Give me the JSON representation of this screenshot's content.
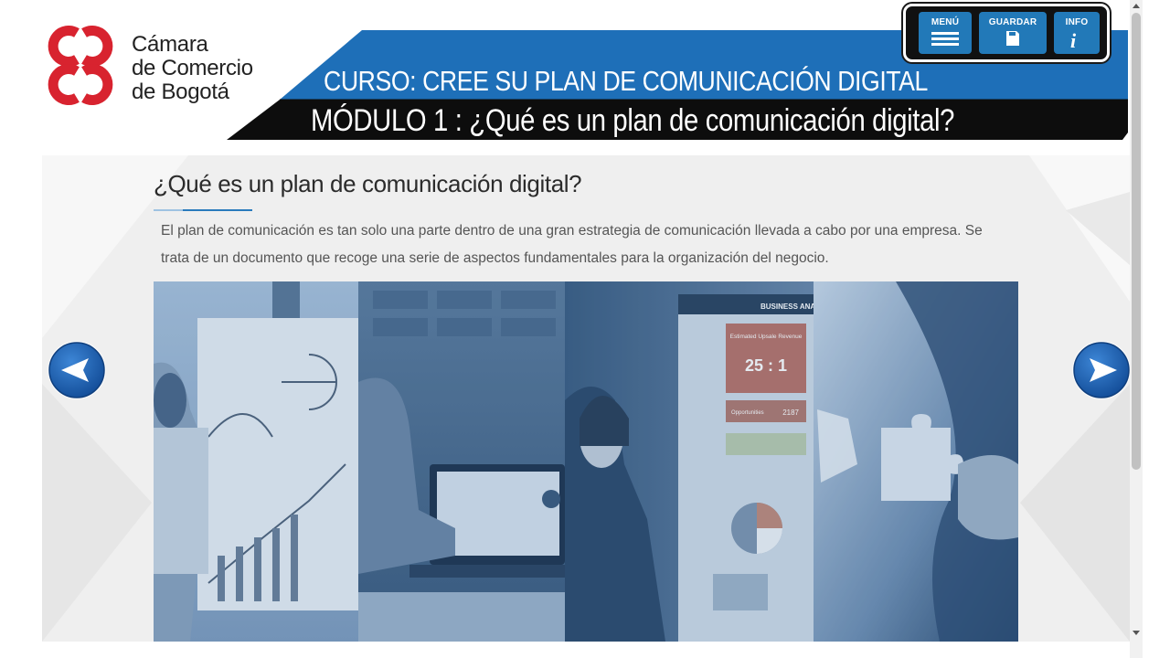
{
  "header": {
    "logo": {
      "line1": "Cámara",
      "line2": "de Comercio",
      "line3": "de Bogotá"
    },
    "course_title": "CURSO: CREE SU PLAN DE COMUNICACIÓN DIGITAL",
    "module_title": "MÓDULO 1 : ¿Qué es un plan de comunicación digital?"
  },
  "toolbar": {
    "menu_label": "MENÚ",
    "save_label": "GUARDAR",
    "info_label": "INFO",
    "menu_icon": "hamburger-icon",
    "save_icon": "floppy-disk-icon",
    "info_icon": "info-icon"
  },
  "content": {
    "title": "¿Qué es un plan de comunicación digital?",
    "paragraph": "El plan de comunicación es tan solo una parte dentro de una gran estrategia de comunicación llevada a cabo por una empresa. Se trata de un documento que recoge una serie de aspectos fundamentales para la organización del negocio.",
    "hero_image": {
      "panels": [
        "whiteboard-presentation",
        "laptop-chart",
        "business-analytics-screen",
        "puzzle-pieces"
      ],
      "screen_text": {
        "header": "BUSINESS ANAL",
        "kpi_label": "Estimated Upsale Revenue",
        "kpi_value": "25 : 1",
        "row_label": "Opportunities",
        "row_value": "2187"
      }
    },
    "prev_icon": "arrow-left-icon",
    "next_icon": "arrow-right-icon"
  },
  "colors": {
    "brand_red": "#d8232f",
    "banner_blue": "#1e6fb8",
    "banner_black": "#0d0d0d",
    "button_blue": "#2279b8",
    "nav_blue": "#1d63b2"
  }
}
